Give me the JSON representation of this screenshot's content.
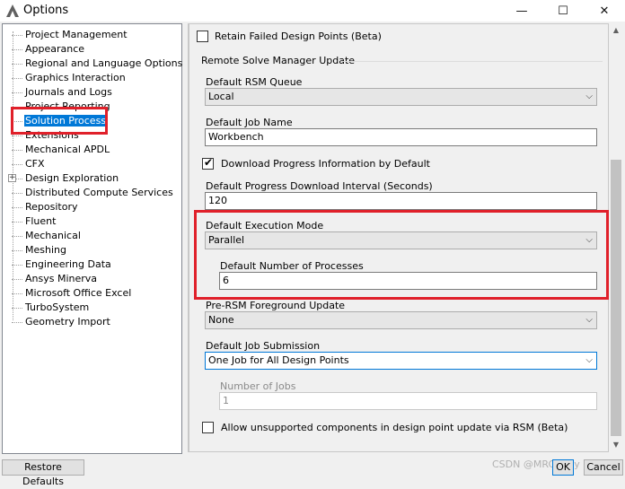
{
  "window": {
    "title": "Options",
    "minimize_glyph": "—",
    "maximize_glyph": "☐",
    "close_glyph": "✕"
  },
  "tree": {
    "items": [
      {
        "label": "Project Management"
      },
      {
        "label": "Appearance"
      },
      {
        "label": "Regional and Language Options"
      },
      {
        "label": "Graphics Interaction"
      },
      {
        "label": "Journals and Logs"
      },
      {
        "label": "Project Reporting"
      },
      {
        "label": "Solution Process",
        "selected": true
      },
      {
        "label": "Extensions"
      },
      {
        "label": "Mechanical APDL"
      },
      {
        "label": "CFX"
      },
      {
        "label": "Design Exploration",
        "expandable": true
      },
      {
        "label": "Distributed Compute Services"
      },
      {
        "label": "Repository"
      },
      {
        "label": "Fluent"
      },
      {
        "label": "Mechanical"
      },
      {
        "label": "Meshing"
      },
      {
        "label": "Engineering Data"
      },
      {
        "label": "Ansys Minerva"
      },
      {
        "label": "Microsoft Office Excel"
      },
      {
        "label": "TurboSystem"
      },
      {
        "label": "Geometry Import"
      }
    ],
    "expander_glyph": "+"
  },
  "panel": {
    "retain_failed": {
      "label": "Retain Failed Design Points (Beta)",
      "checked": false
    },
    "rsm_group_title": "Remote Solve Manager Update",
    "default_rsm_queue": {
      "label": "Default RSM Queue",
      "value": "Local"
    },
    "default_job_name": {
      "label": "Default Job Name",
      "value": "Workbench"
    },
    "download_progress": {
      "label": "Download Progress Information by Default",
      "checked": true,
      "check_glyph": "✔"
    },
    "download_interval": {
      "label": "Default Progress Download Interval (Seconds)",
      "value": "120"
    },
    "execution_mode": {
      "label": "Default Execution Mode",
      "value": "Parallel"
    },
    "num_processes": {
      "label": "Default Number of Processes",
      "value": "6"
    },
    "pre_rsm_update": {
      "label": "Pre-RSM Foreground Update",
      "value": "None"
    },
    "job_submission": {
      "label": "Default Job Submission",
      "value": "One Job for All Design Points"
    },
    "number_of_jobs": {
      "label": "Number of Jobs",
      "value": "1"
    },
    "allow_unsupported": {
      "label": "Allow unsupported components in design point update via RSM (Beta)",
      "checked": false
    },
    "dropdown_glyph": "⌵"
  },
  "scroll": {
    "up_glyph": "▲",
    "down_glyph": "▼"
  },
  "buttons": {
    "restore_defaults": "Restore Defaults",
    "ok": "OK",
    "cancel": "Cancel"
  },
  "watermark": "CSDN @MRC Lzzy",
  "colors": {
    "highlight": "#e0202a",
    "selection": "#0078d7"
  }
}
